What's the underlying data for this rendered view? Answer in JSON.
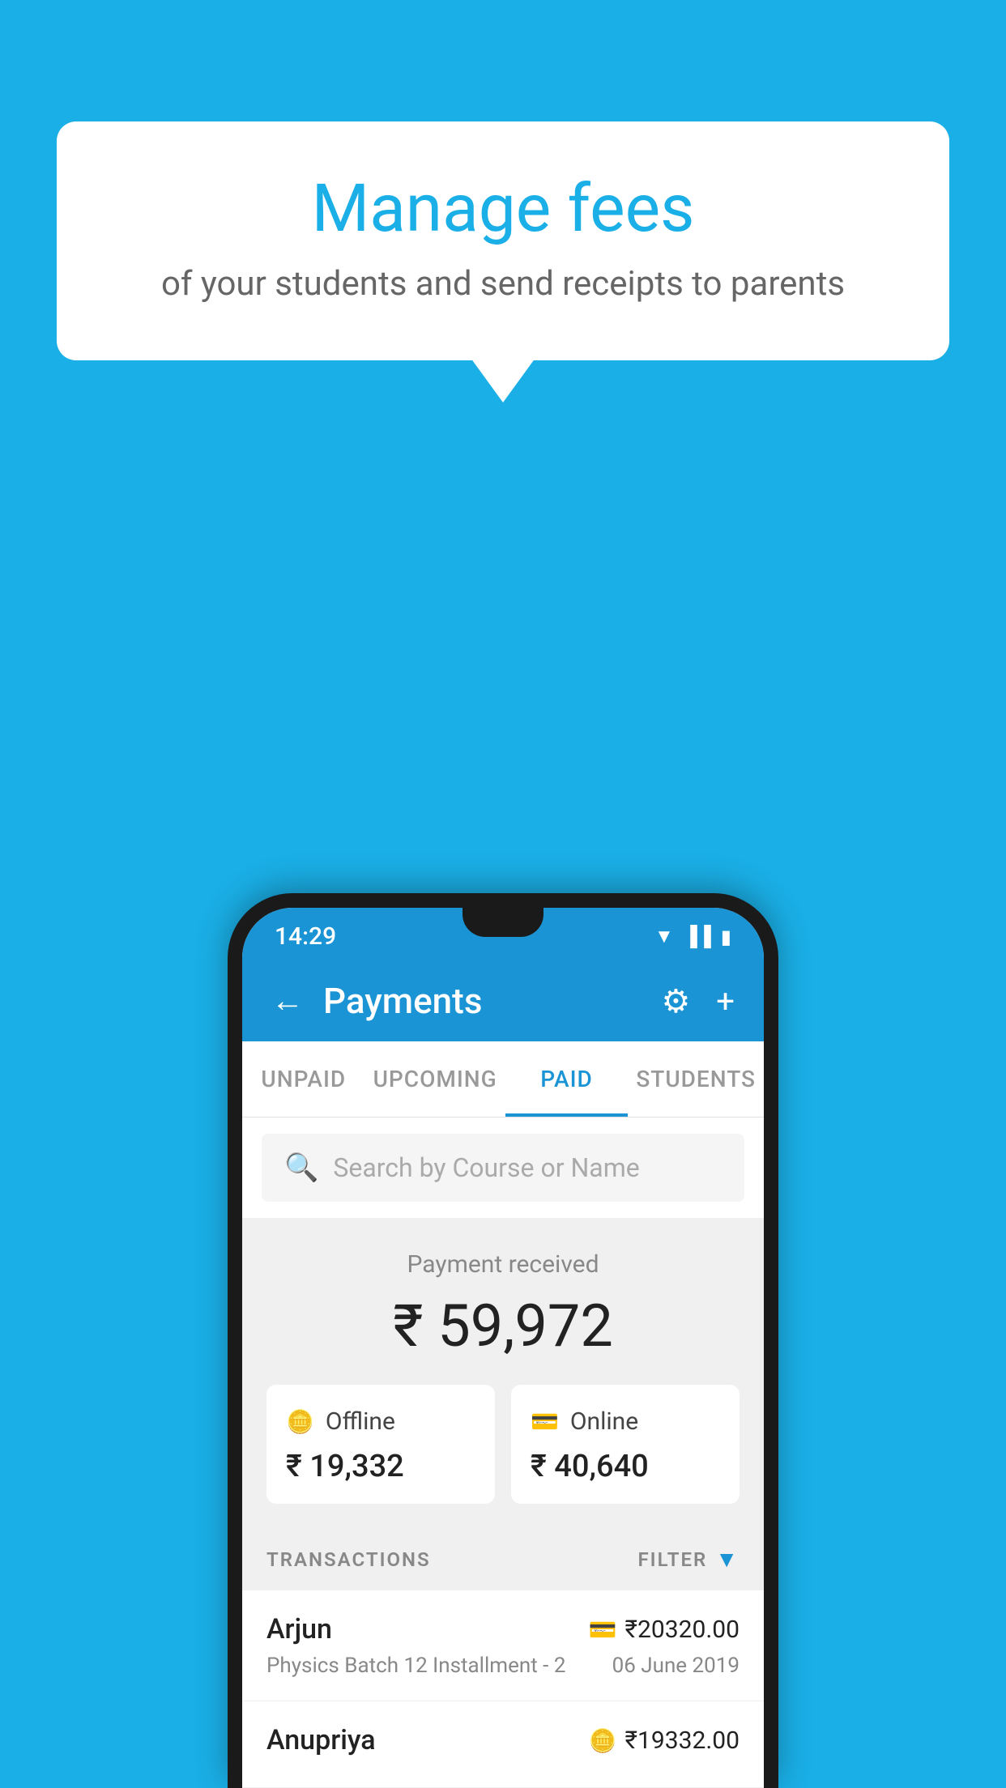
{
  "background_color": "#1aafe6",
  "speech_bubble": {
    "title": "Manage fees",
    "subtitle": "of your students and send receipts to parents"
  },
  "status_bar": {
    "time": "14:29",
    "wifi": "▼",
    "signal": "▐",
    "battery": "▮"
  },
  "header": {
    "back_label": "←",
    "title": "Payments",
    "settings_icon": "⚙",
    "add_icon": "+"
  },
  "tabs": [
    {
      "label": "UNPAID",
      "active": false
    },
    {
      "label": "UPCOMING",
      "active": false
    },
    {
      "label": "PAID",
      "active": true
    },
    {
      "label": "STUDENTS",
      "active": false
    }
  ],
  "search": {
    "placeholder": "Search by Course or Name"
  },
  "payment_summary": {
    "label": "Payment received",
    "total": "₹ 59,972",
    "offline": {
      "icon": "💳",
      "label": "Offline",
      "amount": "₹ 19,332"
    },
    "online": {
      "icon": "💳",
      "label": "Online",
      "amount": "₹ 40,640"
    }
  },
  "transactions_header": {
    "label": "TRANSACTIONS",
    "filter_label": "FILTER"
  },
  "transactions": [
    {
      "name": "Arjun",
      "course": "Physics Batch 12 Installment - 2",
      "amount": "₹20320.00",
      "date": "06 June 2019",
      "payment_type": "online"
    },
    {
      "name": "Anupriya",
      "course": "",
      "amount": "₹19332.00",
      "date": "",
      "payment_type": "offline"
    }
  ]
}
